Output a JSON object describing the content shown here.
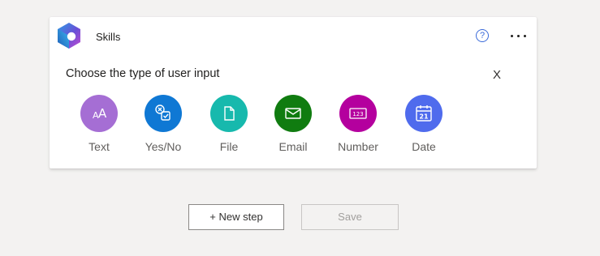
{
  "card": {
    "title": "Skills",
    "help_glyph": "?",
    "more_icon": "more-icon",
    "prompt": "Choose the type of user input",
    "close_label": "X"
  },
  "options": [
    {
      "label": "Text",
      "icon": "text-input-icon",
      "color": "#a56ed4"
    },
    {
      "label": "Yes/No",
      "icon": "yes-no-icon",
      "color": "#0f78d4"
    },
    {
      "label": "File",
      "icon": "file-icon",
      "color": "#17b9ad"
    },
    {
      "label": "Email",
      "icon": "email-icon",
      "color": "#107c10"
    },
    {
      "label": "Number",
      "icon": "number-icon",
      "color": "#b4009e"
    },
    {
      "label": "Date",
      "icon": "calendar-icon",
      "color": "#4f6bed"
    }
  ],
  "number_icon_text": "123",
  "date_icon_text": "21",
  "buttons": {
    "new_step": "+ New step",
    "save": "Save"
  }
}
